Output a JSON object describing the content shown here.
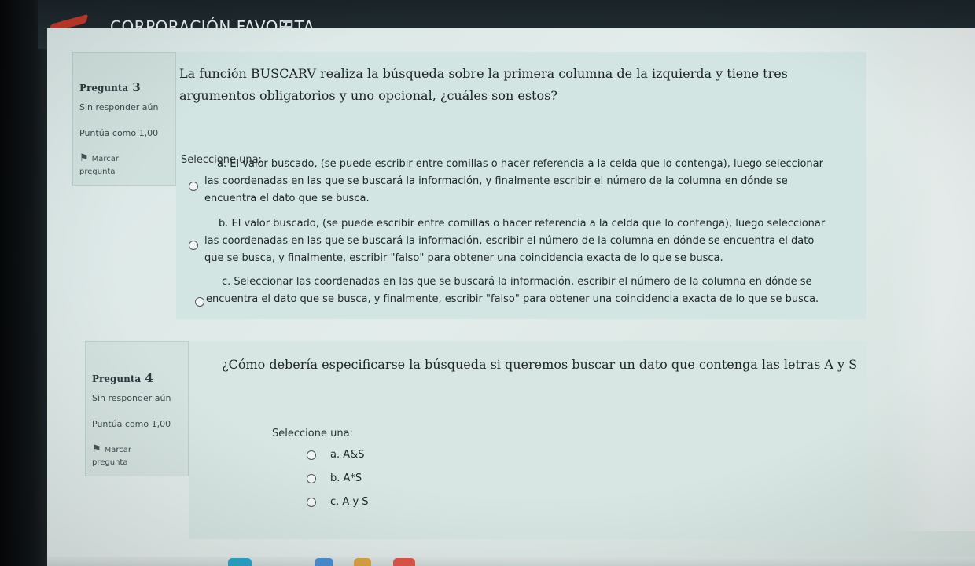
{
  "header": {
    "site_title": "CORPORACIÓN FAVORITA",
    "menu_icon": "hamburger-icon"
  },
  "questions": [
    {
      "label": "Pregunta",
      "number": "3",
      "state": "Sin responder aún",
      "score": "Puntúa como 1,00",
      "flag_label": "Marcar",
      "flag_label_2": "pregunta",
      "text": "La función BUSCARV realiza la búsqueda sobre la primera columna de la izquierda y tiene tres argumentos obligatorios y uno opcional, ¿cuáles son estos?",
      "select_prompt": "Seleccione una:",
      "options": [
        "a. El valor buscado, (se puede escribir entre comillas o hacer referencia a la celda que lo contenga), luego seleccionar las coordenadas en las que se buscará la información, y finalmente escribir el número de la columna en dónde se encuentra el dato que se busca.",
        "b. El valor buscado, (se puede escribir entre comillas o hacer referencia a la celda que lo contenga), luego seleccionar las coordenadas en las que se buscará la información, escribir el número de la columna en dónde se encuentra el dato que se busca, y finalmente, escribir \"falso\" para obtener una coincidencia exacta de lo que se busca.",
        "c. Seleccionar las coordenadas en las que se buscará la información, escribir el número de la columna en dónde se encuentra el dato que se busca, y finalmente, escribir \"falso\" para obtener una coincidencia exacta de lo que se busca."
      ]
    },
    {
      "label": "Pregunta",
      "number": "4",
      "state": "Sin responder aún",
      "score": "Puntúa como 1,00",
      "flag_label": "Marcar",
      "flag_label_2": "pregunta",
      "text": "¿Cómo debería especificarse la búsqueda si queremos buscar un dato que contenga las letras A y S",
      "select_prompt": "Seleccione una:",
      "options": [
        "a. A&S",
        "b. A*S",
        "c. A y S"
      ]
    }
  ],
  "colors": {
    "navbar": "#1f2a2f",
    "accent": "#c0392b",
    "card_bg": "#d2e5e2"
  }
}
